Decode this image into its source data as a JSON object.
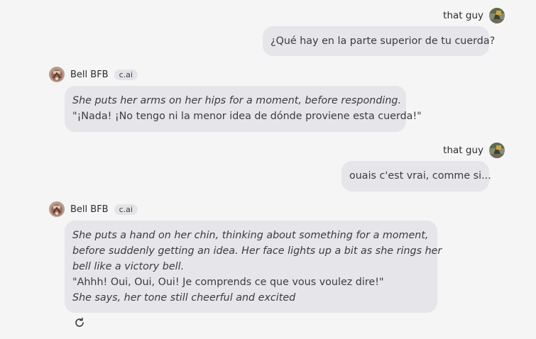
{
  "messages": [
    {
      "role": "user",
      "name": "that guy",
      "text": "¿Qué hay en la parte superior de tu cuerda?"
    },
    {
      "role": "bot",
      "name": "Bell BFB",
      "badge": "c.ai",
      "lines": [
        {
          "text": "She puts her arms on her hips for a moment, before responding.",
          "italic": true
        },
        {
          "text": "\"¡Nada! ¡No tengo ni la menor idea de dónde proviene esta cuerda!\"",
          "italic": false
        }
      ]
    },
    {
      "role": "user",
      "name": "that guy",
      "text": "ouais c'est vrai, comme si..."
    },
    {
      "role": "bot",
      "name": "Bell BFB",
      "badge": "c.ai",
      "lines": [
        {
          "text": "She puts a hand on her chin, thinking about something for a moment,",
          "italic": true
        },
        {
          "text": "before suddenly getting an idea. Her face lights up a bit as she rings her",
          "italic": true
        },
        {
          "text": "bell like a victory bell.",
          "italic": true
        },
        {
          "text": "\"Ahhh! Oui, Oui, Oui! Je comprends ce que vous voulez dire!\"",
          "italic": false
        },
        {
          "text": "She says, her tone still cheerful and excited",
          "italic": true
        }
      ]
    }
  ],
  "icons": {
    "user_avatar": "user-avatar-icon",
    "bot_avatar": "bot-avatar-icon",
    "regenerate": "refresh-icon"
  }
}
